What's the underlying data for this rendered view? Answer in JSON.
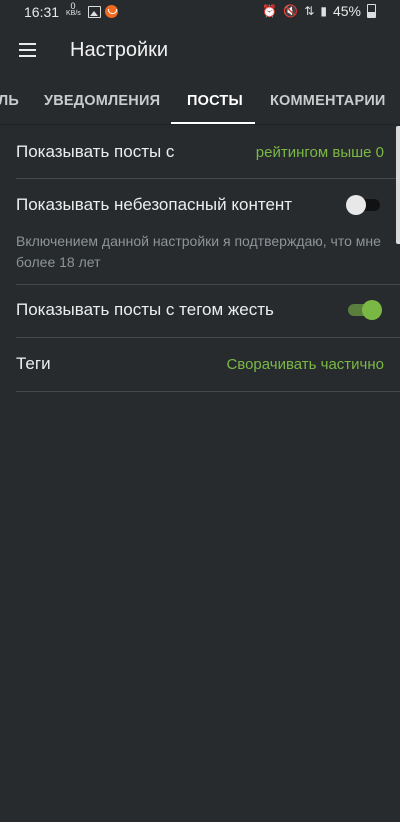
{
  "status_bar": {
    "time": "16:31",
    "speed_value": "0",
    "speed_unit": "KB/s",
    "battery": "45%",
    "icons": [
      "image-icon",
      "app-notification-icon",
      "alarm-icon",
      "mute-icon",
      "data-icon",
      "signal-icon",
      "battery-icon"
    ]
  },
  "app_bar": {
    "title": "Настройки",
    "menu_icon": "menu-icon"
  },
  "tabs": [
    {
      "label": "ЛЬ",
      "active": false
    },
    {
      "label": "УВЕДОМЛЕНИЯ",
      "active": false
    },
    {
      "label": "ПОСТЫ",
      "active": true
    },
    {
      "label": "КОММЕНТАРИИ",
      "active": false
    }
  ],
  "settings": {
    "rating": {
      "label": "Показывать посты с",
      "value": "рейтингом выше 0"
    },
    "unsafe": {
      "label": "Показывать небезопасный контент",
      "enabled": false,
      "note": "Включением данной настройки я подтверждаю, что мне более 18 лет"
    },
    "gore": {
      "label": "Показывать посты с тегом жесть",
      "enabled": true
    },
    "tags": {
      "label": "Теги",
      "value": "Сворачивать частично"
    }
  },
  "colors": {
    "background": "#272b2e",
    "accent": "#7ab845",
    "text": "#eceded",
    "muted": "#8f9497"
  }
}
